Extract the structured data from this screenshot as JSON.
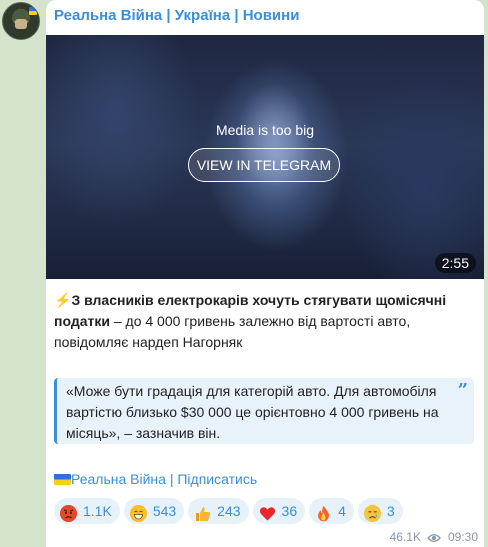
{
  "post": {
    "channel_name": "Реальна Війна | Україна | Новини",
    "media": {
      "notice": "Media is too big",
      "button_label": "VIEW IN TELEGRAM",
      "duration": "2:55"
    },
    "text": {
      "icon": "⚡",
      "headline": "З власників електрокарів хочуть стягувати щомісячні податки",
      "body": " – до 4 000 гривень залежно від вартості авто, повідомляє нардеп Нагорняк"
    },
    "quote": {
      "text": "«Може бути градація для категорій авто. Для автомобіля вартістю близько $30 000 це орієнтовно 4 000 гривень на місяць», – зазначив він.",
      "icon": "quote-mark-icon"
    },
    "subscribe_link": "Реальна Війна | Підписатись",
    "reactions": [
      {
        "icon": "angry-face-icon",
        "count": "1.1K"
      },
      {
        "icon": "grinning-face-icon",
        "count": "543"
      },
      {
        "icon": "thumbs-up-icon",
        "count": "243"
      },
      {
        "icon": "heart-icon",
        "count": "36"
      },
      {
        "icon": "fire-icon",
        "count": "4"
      },
      {
        "icon": "crying-face-icon",
        "count": "3"
      }
    ],
    "views": "46.1K",
    "time": "09:30"
  },
  "colors": {
    "background": "#d4e3cc",
    "accent": "#3a8fd8",
    "quote_bg": "#e8f2fb",
    "reaction_bg": "#e6f1fa"
  }
}
